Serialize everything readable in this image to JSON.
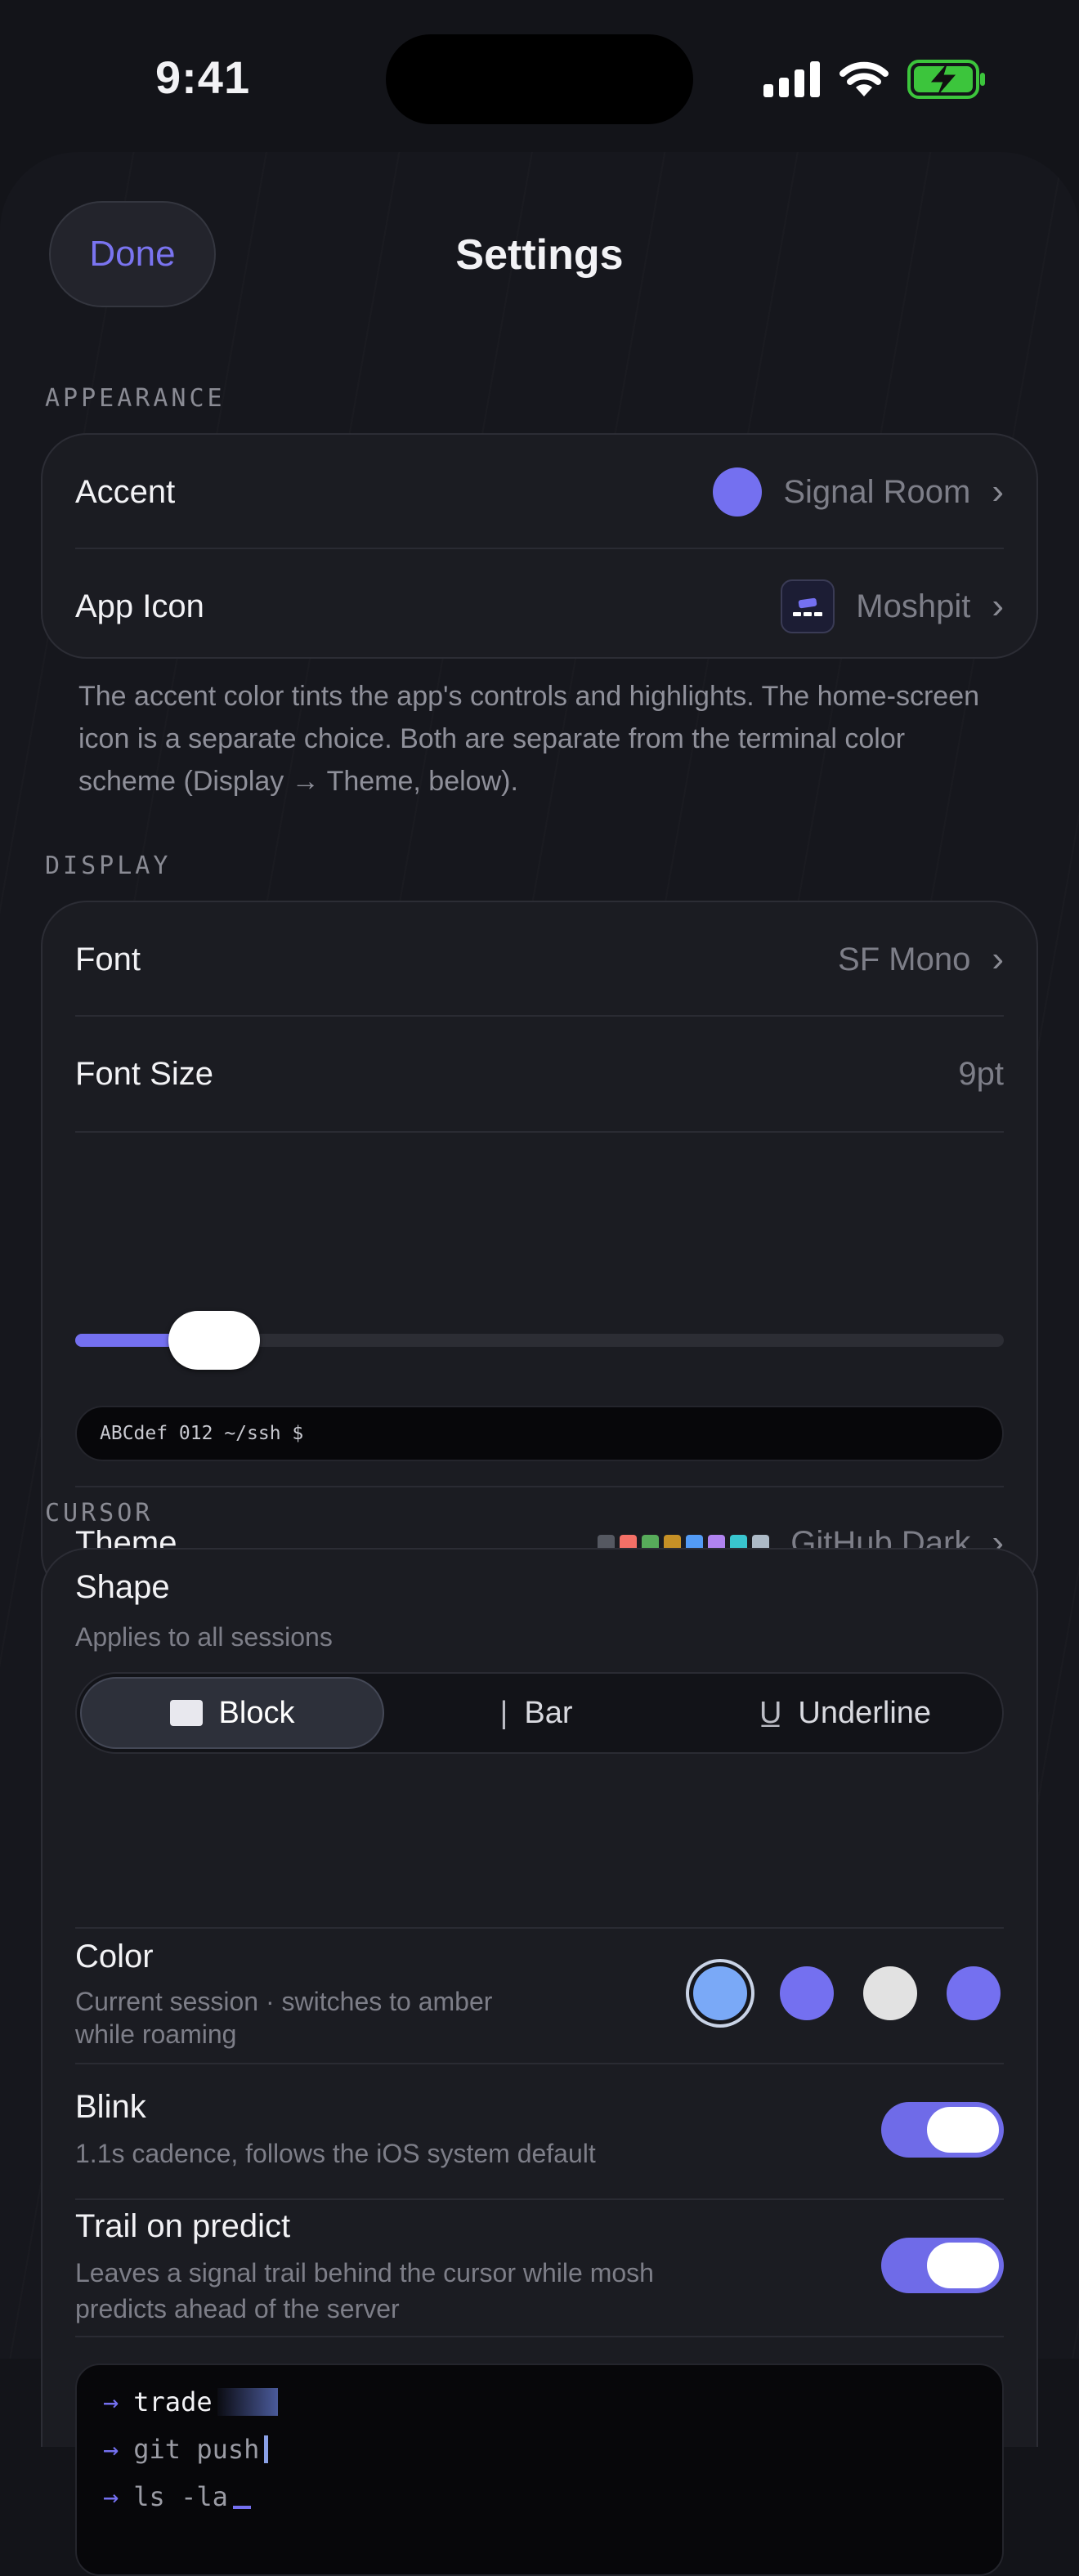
{
  "status_bar": {
    "time": "9:41",
    "icons": [
      "cellular-signal-icon",
      "wifi-icon",
      "battery-charging-icon"
    ]
  },
  "header": {
    "done_label": "Done",
    "title": "Settings"
  },
  "colors": {
    "accent": "#7470f0",
    "toggle_on": "#6f6be8",
    "battery_green": "#3cc53c"
  },
  "appearance": {
    "header": "APPEARANCE",
    "accent": {
      "label": "Accent",
      "value": "Signal Room"
    },
    "app_icon": {
      "label": "App Icon",
      "value": "Moshpit"
    },
    "footnote": "The accent color tints the app's controls and highlights. The home-screen icon is a separate choice. Both are separate from the terminal color scheme (Display → Theme, below)."
  },
  "display": {
    "header": "DISPLAY",
    "font": {
      "label": "Font",
      "value": "SF Mono"
    },
    "font_size": {
      "label": "Font Size",
      "value": "9pt",
      "slider_fraction": 0.15
    },
    "preview_text": "ABCdef 012 ~/ssh $",
    "theme": {
      "label": "Theme",
      "value": "GitHub Dark",
      "swatches": [
        "#555861",
        "#f47067",
        "#57ab5a",
        "#c69026",
        "#539bf5",
        "#b083f0",
        "#39c5cf",
        "#adbac7"
      ]
    }
  },
  "cursor": {
    "header": "CURSOR",
    "shape": {
      "label": "Shape",
      "sub": "Applies to all sessions",
      "options": [
        {
          "label": "Block",
          "glyph": "■",
          "selected": true
        },
        {
          "label": "Bar",
          "glyph": "|",
          "selected": false
        },
        {
          "label": "Underline",
          "glyph": "U̲",
          "selected": false
        }
      ]
    },
    "color": {
      "label": "Color",
      "sub_line1": "Current session · switches to amber",
      "sub_line2": "while roaming",
      "options": [
        "#7aa9f7",
        "#7470f0",
        "#e2e2e2",
        "#7470f0"
      ]
    },
    "blink": {
      "label": "Blink",
      "sub": "1.1s cadence, follows the iOS system default",
      "on": true
    },
    "trail": {
      "label": "Trail on predict",
      "sub_line1": "Leaves a signal trail behind the cursor while mosh",
      "sub_line2": "predicts ahead of the server",
      "on": true
    },
    "terminal_lines": [
      {
        "prompt": "→",
        "text": "trade"
      },
      {
        "prompt": "→",
        "text": "git push"
      },
      {
        "prompt": "→",
        "text": "ls -la"
      }
    ]
  }
}
